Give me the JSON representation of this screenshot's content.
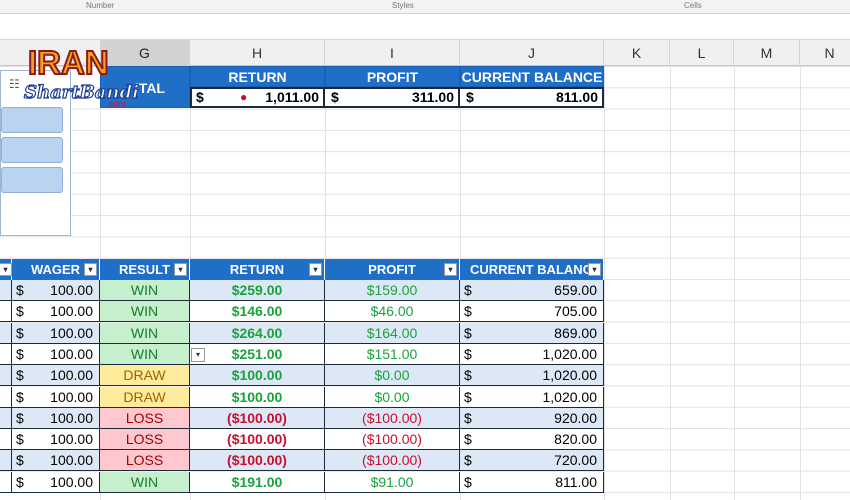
{
  "ribbon": {
    "group_number": "Number",
    "group_styles": "Styles",
    "group_cells": "Cells"
  },
  "columns": {
    "g": "G",
    "h": "H",
    "i": "I",
    "j": "J",
    "k": "K",
    "l": "L",
    "m": "M",
    "n": "N"
  },
  "logo": {
    "line1": "IRAN",
    "line2": "ShartBandi",
    "line3": ".com"
  },
  "summary": {
    "capital_label_partial": "ITAL",
    "return_label": "RETURN",
    "profit_label": "PROFIT",
    "balance_label": "CURRENT BALANCE",
    "currency": "$",
    "return_value": "1,011.00",
    "profit_value": "311.00",
    "balance_value": "811.00"
  },
  "table": {
    "headers": {
      "wager": "WAGER",
      "result": "RESULT",
      "return": "RETURN",
      "profit": "PROFIT",
      "balance": "CURRENT BALANCE"
    },
    "dropdown_glyph": "▾",
    "currency": "$",
    "rows": [
      {
        "wager": "100.00",
        "result": "WIN",
        "ret": "$259.00",
        "profit": "$159.00",
        "balance": "659.00"
      },
      {
        "wager": "100.00",
        "result": "WIN",
        "ret": "$146.00",
        "profit": "$46.00",
        "balance": "705.00"
      },
      {
        "wager": "100.00",
        "result": "WIN",
        "ret": "$264.00",
        "profit": "$164.00",
        "balance": "869.00"
      },
      {
        "wager": "100.00",
        "result": "WIN",
        "ret": "$251.00",
        "profit": "$151.00",
        "balance": "1,020.00"
      },
      {
        "wager": "100.00",
        "result": "DRAW",
        "ret": "$100.00",
        "profit": "$0.00",
        "balance": "1,020.00"
      },
      {
        "wager": "100.00",
        "result": "DRAW",
        "ret": "$100.00",
        "profit": "$0.00",
        "balance": "1,020.00"
      },
      {
        "wager": "100.00",
        "result": "LOSS",
        "ret": "($100.00)",
        "profit": "($100.00)",
        "balance": "920.00"
      },
      {
        "wager": "100.00",
        "result": "LOSS",
        "ret": "($100.00)",
        "profit": "($100.00)",
        "balance": "820.00"
      },
      {
        "wager": "100.00",
        "result": "LOSS",
        "ret": "($100.00)",
        "profit": "($100.00)",
        "balance": "720.00"
      },
      {
        "wager": "100.00",
        "result": "WIN",
        "ret": "$191.00",
        "profit": "$91.00",
        "balance": "811.00"
      }
    ]
  },
  "colors": {
    "header_blue": "#1f6fc9",
    "win_fill": "#c6efce",
    "draw_fill": "#ffeb9c",
    "loss_fill": "#ffc7ce"
  }
}
